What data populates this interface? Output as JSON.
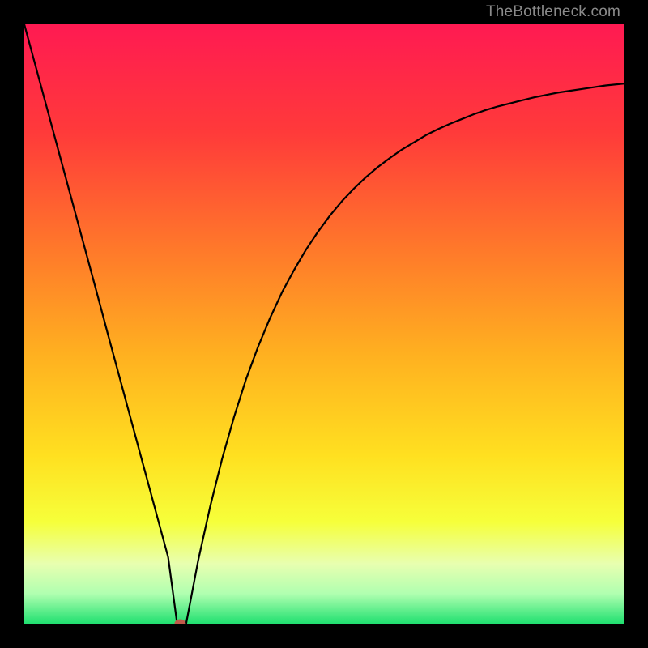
{
  "attribution": "TheBottleneck.com",
  "chart_data": {
    "type": "line",
    "title": "",
    "xlabel": "",
    "ylabel": "",
    "xlim": [
      0,
      1
    ],
    "ylim": [
      0,
      1
    ],
    "grid": false,
    "legend": false,
    "marker": {
      "x": 0.26,
      "y": 0.0,
      "color": "#c05a4a"
    },
    "gradient_stops": [
      {
        "offset": 0.0,
        "color": "#ff1a52"
      },
      {
        "offset": 0.18,
        "color": "#ff3a3a"
      },
      {
        "offset": 0.38,
        "color": "#ff7a2a"
      },
      {
        "offset": 0.55,
        "color": "#ffb020"
      },
      {
        "offset": 0.72,
        "color": "#ffe020"
      },
      {
        "offset": 0.83,
        "color": "#f6ff3a"
      },
      {
        "offset": 0.9,
        "color": "#e8ffb0"
      },
      {
        "offset": 0.95,
        "color": "#b0ffb0"
      },
      {
        "offset": 1.0,
        "color": "#20e070"
      }
    ],
    "series": [
      {
        "name": "left-branch",
        "x": [
          0.0,
          0.02,
          0.04,
          0.06,
          0.08,
          0.1,
          0.12,
          0.14,
          0.16,
          0.18,
          0.2,
          0.22,
          0.24,
          0.255
        ],
        "values": [
          1.0,
          0.926,
          0.852,
          0.778,
          0.704,
          0.63,
          0.556,
          0.481,
          0.407,
          0.333,
          0.259,
          0.185,
          0.111,
          0.0
        ]
      },
      {
        "name": "flat-bottom",
        "x": [
          0.255,
          0.26,
          0.265,
          0.27
        ],
        "values": [
          0.0,
          0.0,
          0.0,
          0.0
        ]
      },
      {
        "name": "right-branch",
        "x": [
          0.27,
          0.29,
          0.31,
          0.33,
          0.35,
          0.37,
          0.39,
          0.41,
          0.43,
          0.45,
          0.47,
          0.49,
          0.51,
          0.53,
          0.55,
          0.57,
          0.59,
          0.61,
          0.63,
          0.65,
          0.67,
          0.69,
          0.71,
          0.73,
          0.75,
          0.77,
          0.79,
          0.81,
          0.83,
          0.85,
          0.87,
          0.89,
          0.91,
          0.93,
          0.95,
          0.97,
          0.99,
          1.0
        ],
        "values": [
          0.0,
          0.105,
          0.195,
          0.275,
          0.345,
          0.408,
          0.462,
          0.51,
          0.553,
          0.59,
          0.624,
          0.654,
          0.681,
          0.705,
          0.726,
          0.745,
          0.762,
          0.777,
          0.791,
          0.803,
          0.815,
          0.825,
          0.834,
          0.842,
          0.85,
          0.857,
          0.863,
          0.868,
          0.873,
          0.878,
          0.882,
          0.886,
          0.889,
          0.892,
          0.895,
          0.898,
          0.9,
          0.901
        ]
      }
    ]
  }
}
